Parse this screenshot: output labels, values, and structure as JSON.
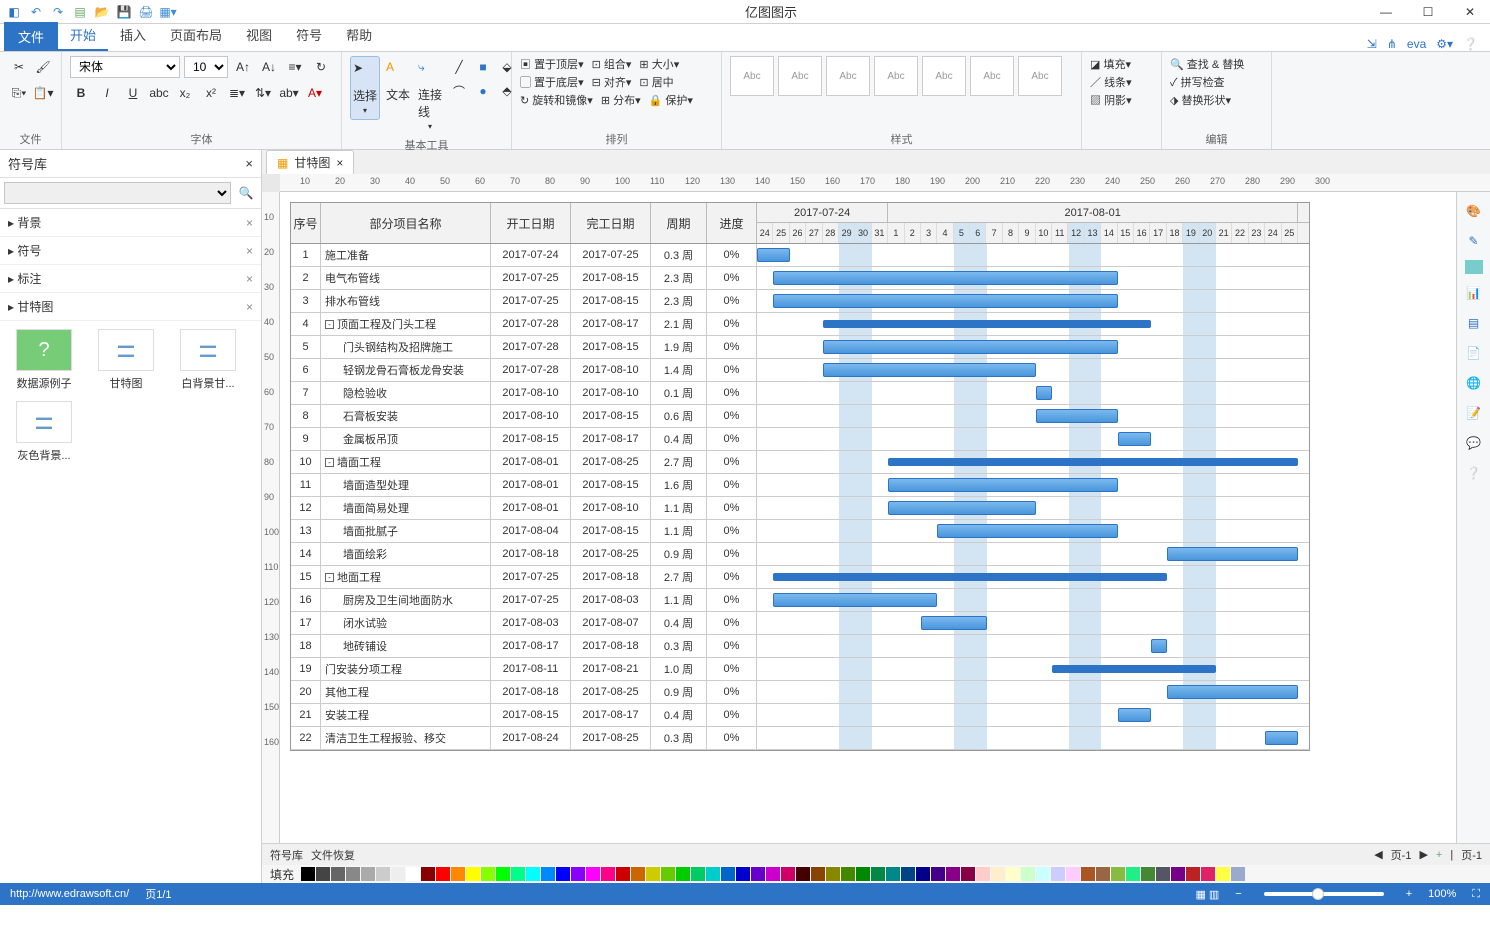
{
  "app_title": "亿图图示",
  "qat": [
    "logo",
    "undo",
    "redo",
    "new",
    "open",
    "save",
    "print",
    "export"
  ],
  "ribbon": {
    "file": "文件",
    "tabs": [
      "开始",
      "插入",
      "页面布局",
      "视图",
      "符号",
      "帮助"
    ],
    "active": "开始",
    "user": "eva",
    "clipboard_label": "文件",
    "font": {
      "family": "宋体",
      "size": "10",
      "label": "字体"
    },
    "tools": {
      "select": "选择",
      "text": "文本",
      "connector": "连接线",
      "label": "基本工具"
    },
    "arrange": {
      "front": "置于顶层",
      "back": "置于底层",
      "rotate": "旋转和镜像",
      "group": "组合",
      "align": "对齐",
      "distribute": "分布",
      "size": "大小",
      "center": "居中",
      "lock": "保护",
      "label": "排列"
    },
    "style": {
      "sample": "Abc",
      "label": "样式"
    },
    "format": {
      "fill": "填充",
      "line": "线条",
      "shadow": "阴影",
      "label": ""
    },
    "edit": {
      "find": "查找 & 替换",
      "spell": "拼写检查",
      "change": "替换形状",
      "label": "编辑"
    }
  },
  "sidebar": {
    "title": "符号库",
    "cats": [
      {
        "n": "背景"
      },
      {
        "n": "符号"
      },
      {
        "n": "标注"
      },
      {
        "n": "甘特图"
      }
    ],
    "shapes": [
      "数据源例子",
      "甘特图",
      "白背景甘...",
      "灰色背景..."
    ]
  },
  "doc_tab": "甘特图",
  "ruler_marks": [
    10,
    20,
    30,
    40,
    50,
    60,
    70,
    80,
    90,
    100,
    110,
    120,
    130,
    140,
    150,
    160,
    170,
    180,
    190,
    200,
    210,
    220,
    230,
    240,
    250,
    260,
    270,
    280,
    290,
    300
  ],
  "ruler_v": [
    10,
    20,
    30,
    40,
    50,
    60,
    70,
    80,
    90,
    100,
    110,
    120,
    130,
    140,
    150,
    160
  ],
  "gantt": {
    "cols": {
      "no": "序号",
      "name": "部分项目名称",
      "start": "开工日期",
      "end": "完工日期",
      "period": "周期",
      "progress": "进度"
    },
    "weeks": [
      {
        "label": "2017-07-24",
        "span": 8
      },
      {
        "label": "2017-08-01",
        "span": 25
      }
    ],
    "days": [
      "24",
      "25",
      "26",
      "27",
      "28",
      "29",
      "30",
      "31",
      "1",
      "2",
      "3",
      "4",
      "5",
      "6",
      "7",
      "8",
      "9",
      "10",
      "11",
      "12",
      "13",
      "14",
      "15",
      "16",
      "17",
      "18",
      "19",
      "20",
      "21",
      "22",
      "23",
      "24",
      "25"
    ],
    "weekend_idx": [
      5,
      6,
      12,
      13,
      19,
      20,
      26,
      27
    ],
    "rows": [
      {
        "no": 1,
        "name": "施工准备",
        "start": "2017-07-24",
        "end": "2017-07-25",
        "period": "0.3 周",
        "prog": "0%",
        "bs": 0,
        "be": 2
      },
      {
        "no": 2,
        "name": "电气布管线",
        "start": "2017-07-25",
        "end": "2017-08-15",
        "period": "2.3 周",
        "prog": "0%",
        "bs": 1,
        "be": 22
      },
      {
        "no": 3,
        "name": "排水布管线",
        "start": "2017-07-25",
        "end": "2017-08-15",
        "period": "2.3 周",
        "prog": "0%",
        "bs": 1,
        "be": 22
      },
      {
        "no": 4,
        "name": "顶面工程及门头工程",
        "start": "2017-07-28",
        "end": "2017-08-17",
        "period": "2.1 周",
        "prog": "0%",
        "bs": 4,
        "be": 24,
        "expand": true,
        "summary": true
      },
      {
        "no": 5,
        "name": "门头钢结构及招牌施工",
        "start": "2017-07-28",
        "end": "2017-08-15",
        "period": "1.9 周",
        "prog": "0%",
        "bs": 4,
        "be": 22,
        "indent": 1
      },
      {
        "no": 6,
        "name": "轻钢龙骨石膏板龙骨安装",
        "start": "2017-07-28",
        "end": "2017-08-10",
        "period": "1.4 周",
        "prog": "0%",
        "bs": 4,
        "be": 17,
        "indent": 1
      },
      {
        "no": 7,
        "name": "隐检验收",
        "start": "2017-08-10",
        "end": "2017-08-10",
        "period": "0.1 周",
        "prog": "0%",
        "bs": 17,
        "be": 18,
        "indent": 1
      },
      {
        "no": 8,
        "name": "石膏板安装",
        "start": "2017-08-10",
        "end": "2017-08-15",
        "period": "0.6 周",
        "prog": "0%",
        "bs": 17,
        "be": 22,
        "indent": 1
      },
      {
        "no": 9,
        "name": "金属板吊顶",
        "start": "2017-08-15",
        "end": "2017-08-17",
        "period": "0.4 周",
        "prog": "0%",
        "bs": 22,
        "be": 24,
        "indent": 1
      },
      {
        "no": 10,
        "name": "墙面工程",
        "start": "2017-08-01",
        "end": "2017-08-25",
        "period": "2.7 周",
        "prog": "0%",
        "bs": 8,
        "be": 33,
        "expand": true,
        "summary": true
      },
      {
        "no": 11,
        "name": "墙面造型处理",
        "start": "2017-08-01",
        "end": "2017-08-15",
        "period": "1.6 周",
        "prog": "0%",
        "bs": 8,
        "be": 22,
        "indent": 1
      },
      {
        "no": 12,
        "name": "墙面简易处理",
        "start": "2017-08-01",
        "end": "2017-08-10",
        "period": "1.1 周",
        "prog": "0%",
        "bs": 8,
        "be": 17,
        "indent": 1
      },
      {
        "no": 13,
        "name": "墙面批腻子",
        "start": "2017-08-04",
        "end": "2017-08-15",
        "period": "1.1 周",
        "prog": "0%",
        "bs": 11,
        "be": 22,
        "indent": 1
      },
      {
        "no": 14,
        "name": "墙面绘彩",
        "start": "2017-08-18",
        "end": "2017-08-25",
        "period": "0.9 周",
        "prog": "0%",
        "bs": 25,
        "be": 33,
        "indent": 1
      },
      {
        "no": 15,
        "name": "地面工程",
        "start": "2017-07-25",
        "end": "2017-08-18",
        "period": "2.7 周",
        "prog": "0%",
        "bs": 1,
        "be": 25,
        "expand": true,
        "summary": true
      },
      {
        "no": 16,
        "name": "厨房及卫生间地面防水",
        "start": "2017-07-25",
        "end": "2017-08-03",
        "period": "1.1 周",
        "prog": "0%",
        "bs": 1,
        "be": 11,
        "indent": 1
      },
      {
        "no": 17,
        "name": "闭水试验",
        "start": "2017-08-03",
        "end": "2017-08-07",
        "period": "0.4 周",
        "prog": "0%",
        "bs": 10,
        "be": 14,
        "indent": 1
      },
      {
        "no": 18,
        "name": "地砖铺设",
        "start": "2017-08-17",
        "end": "2017-08-18",
        "period": "0.3 周",
        "prog": "0%",
        "bs": 24,
        "be": 25,
        "indent": 1
      },
      {
        "no": 19,
        "name": "门安装分项工程",
        "start": "2017-08-11",
        "end": "2017-08-21",
        "period": "1.0 周",
        "prog": "0%",
        "bs": 18,
        "be": 28,
        "summary": true
      },
      {
        "no": 20,
        "name": "其他工程",
        "start": "2017-08-18",
        "end": "2017-08-25",
        "period": "0.9 周",
        "prog": "0%",
        "bs": 25,
        "be": 33
      },
      {
        "no": 21,
        "name": "安装工程",
        "start": "2017-08-15",
        "end": "2017-08-17",
        "period": "0.4 周",
        "prog": "0%",
        "bs": 22,
        "be": 24
      },
      {
        "no": 22,
        "name": "清洁卫生工程报验、移交",
        "start": "2017-08-24",
        "end": "2017-08-25",
        "period": "0.3 周",
        "prog": "0%",
        "bs": 31,
        "be": 33
      }
    ]
  },
  "page_bar": {
    "sym": "符号库",
    "recover": "文件恢复",
    "page_nav": "页-1",
    "page_nav2": "页-1",
    "fill": "填充"
  },
  "status": {
    "url": "http://www.edrawsoft.cn/",
    "page": "页1/1",
    "zoom": "100%"
  },
  "palette": [
    "#000",
    "#444",
    "#666",
    "#888",
    "#aaa",
    "#ccc",
    "#eee",
    "#fff",
    "#800",
    "#f00",
    "#f80",
    "#ff0",
    "#8f0",
    "#0f0",
    "#0f8",
    "#0ff",
    "#08f",
    "#00f",
    "#80f",
    "#f0f",
    "#f08",
    "#c00",
    "#c60",
    "#cc0",
    "#6c0",
    "#0c0",
    "#0c6",
    "#0cc",
    "#06c",
    "#00c",
    "#60c",
    "#c0c",
    "#c06",
    "#400",
    "#840",
    "#880",
    "#480",
    "#080",
    "#084",
    "#088",
    "#048",
    "#008",
    "#408",
    "#808",
    "#804",
    "#fcc",
    "#fec",
    "#ffc",
    "#cfc",
    "#cff",
    "#ccf",
    "#fcf",
    "#a52",
    "#964",
    "#8b4",
    "#2e8",
    "#483",
    "#556",
    "#708",
    "#b22",
    "#d26",
    "#ff4",
    "#9ac"
  ]
}
